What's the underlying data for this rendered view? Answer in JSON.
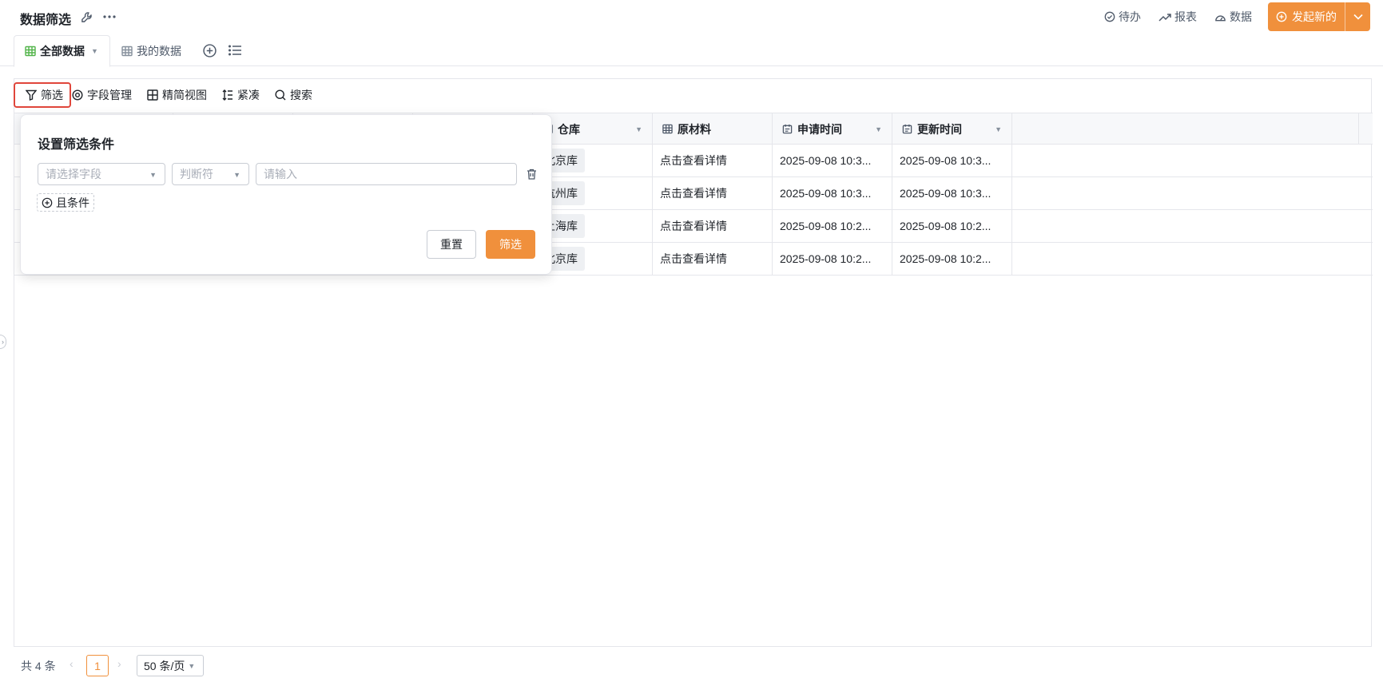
{
  "header": {
    "title": "数据筛选",
    "actions": {
      "todo": "待办",
      "report": "报表",
      "data": "数据",
      "start_new": "发起新的"
    }
  },
  "tabs": {
    "all_data": "全部数据",
    "my_data": "我的数据"
  },
  "toolbar": {
    "filter": "筛选",
    "field_manage": "字段管理",
    "compact_view": "精简视图",
    "dense": "紧凑",
    "search": "搜索"
  },
  "table": {
    "columns": {
      "warehouse": "仓库",
      "material": "原材料",
      "apply_time": "申请时间",
      "update_time": "更新时间"
    },
    "rows": [
      {
        "warehouse": "北京库",
        "material": "点击查看详情",
        "apply_time": "2025-09-08 10:3...",
        "update_time": "2025-09-08 10:3..."
      },
      {
        "warehouse": "杭州库",
        "material": "点击查看详情",
        "apply_time": "2025-09-08 10:3...",
        "update_time": "2025-09-08 10:3..."
      },
      {
        "warehouse": "上海库",
        "material": "点击查看详情",
        "apply_time": "2025-09-08 10:2...",
        "update_time": "2025-09-08 10:2..."
      },
      {
        "warehouse": "北京库",
        "material": "点击查看详情",
        "apply_time": "2025-09-08 10:2...",
        "update_time": "2025-09-08 10:2..."
      }
    ]
  },
  "filter_popover": {
    "title": "设置筛选条件",
    "field_placeholder": "请选择字段",
    "operator_placeholder": "判断符",
    "value_placeholder": "请输入",
    "and_condition": "且条件",
    "reset": "重置",
    "apply": "筛选"
  },
  "pagination": {
    "total": "共 4 条",
    "current_page": "1",
    "page_size": "50 条/页"
  },
  "colors": {
    "accent": "#f0903c",
    "highlight_border": "#e0463b",
    "grid_icon_active": "#52b44a"
  }
}
